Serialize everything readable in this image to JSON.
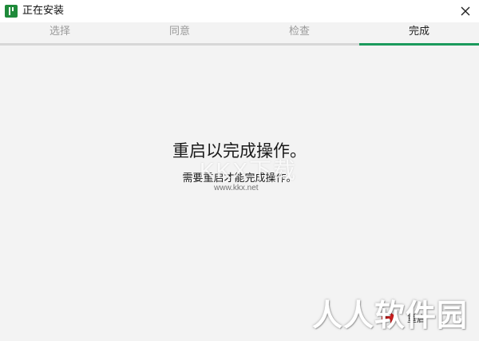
{
  "window": {
    "title": "正在安装",
    "app_icon": "app-logo-icon",
    "close_icon": "close-icon"
  },
  "tabs": [
    {
      "label": "选择",
      "active": false
    },
    {
      "label": "同意",
      "active": false
    },
    {
      "label": "检查",
      "active": false
    },
    {
      "label": "完成",
      "active": true
    }
  ],
  "main": {
    "headline": "重启以完成操作。",
    "subline": "需要重启才能完成操作。",
    "restart_button_label": "重启"
  },
  "watermarks": {
    "kkx_logo": "KKX下载",
    "kkx_url": "www.kkx.net",
    "site_logo": "人人软件园"
  },
  "colors": {
    "accent": "#1b9a5c",
    "background": "#f3f3f3",
    "titlebar": "#ffffff",
    "inactive_tab": "#9a9a9a"
  }
}
